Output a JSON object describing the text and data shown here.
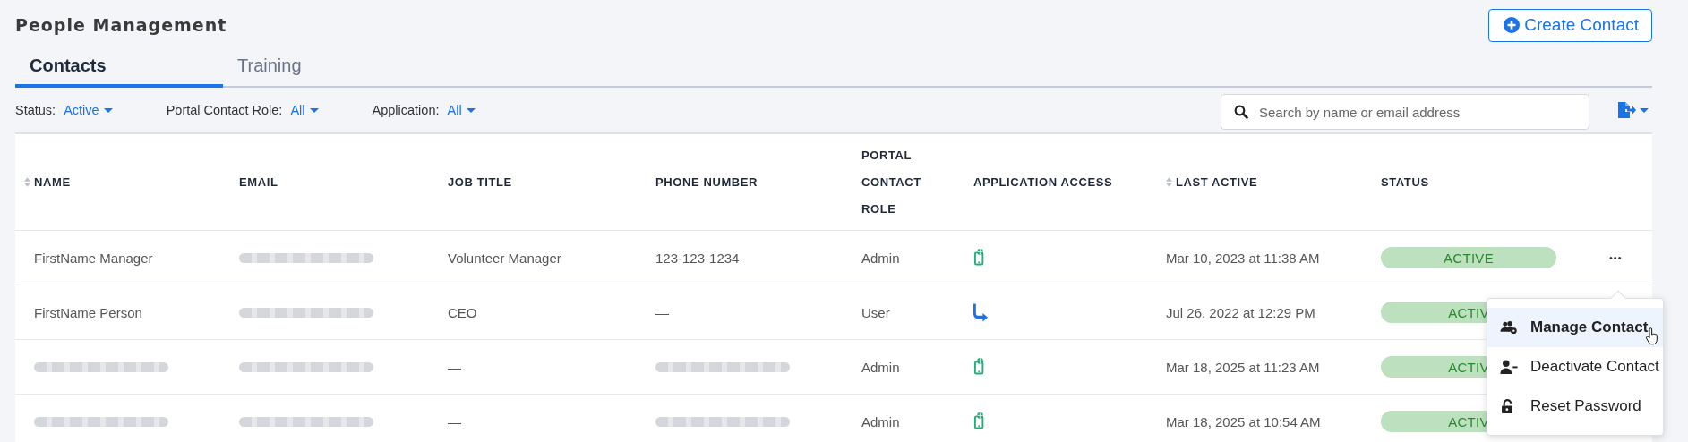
{
  "page": {
    "title": "People Management",
    "create_button": "Create Contact"
  },
  "tabs": [
    {
      "label": "Contacts",
      "selected": true
    },
    {
      "label": "Training",
      "selected": false
    }
  ],
  "filters": [
    {
      "label": "Status:",
      "value": "Active"
    },
    {
      "label": "Portal Contact Role:",
      "value": "All"
    },
    {
      "label": "Application:",
      "value": "All"
    }
  ],
  "search": {
    "placeholder": "Search by name or email address"
  },
  "table": {
    "columns": [
      {
        "label": "NAME",
        "sortable": true
      },
      {
        "label": "EMAIL",
        "sortable": false
      },
      {
        "label": "JOB TITLE",
        "sortable": false
      },
      {
        "label": "PHONE NUMBER",
        "sortable": false
      },
      {
        "label": "PORTAL CONTACT ROLE",
        "sortable": false
      },
      {
        "label": "APPLICATION ACCESS",
        "sortable": false
      },
      {
        "label": "LAST ACTIVE",
        "sortable": true
      },
      {
        "label": "STATUS",
        "sortable": false
      }
    ],
    "rows": [
      {
        "name": {
          "kind": "text",
          "text": "FirstName Manager"
        },
        "email": {
          "kind": "blurred"
        },
        "job_title": "Volunteer Manager",
        "phone": {
          "kind": "text",
          "text": "123-123-1234"
        },
        "role": "Admin",
        "access": {
          "kind": "phone"
        },
        "last_active": "Mar 10, 2023 at 11:38 AM",
        "status": "ACTIVE",
        "actions": "•••"
      },
      {
        "name": {
          "kind": "text",
          "text": "FirstName Person"
        },
        "email": {
          "kind": "blurred"
        },
        "job_title": "CEO",
        "phone": {
          "kind": "text",
          "text": "—"
        },
        "role": "User",
        "access": {
          "kind": "arrow"
        },
        "last_active": "Jul 26, 2022 at 12:29 PM",
        "status": "ACTIV"
      },
      {
        "name": {
          "kind": "blurred"
        },
        "email": {
          "kind": "blurred"
        },
        "job_title": "—",
        "phone": {
          "kind": "blurred"
        },
        "role": "Admin",
        "access": {
          "kind": "phone"
        },
        "last_active": "Mar 18, 2025 at 11:23 AM",
        "status": "ACTIV"
      },
      {
        "name": {
          "kind": "blurred"
        },
        "email": {
          "kind": "blurred"
        },
        "job_title": "—",
        "phone": {
          "kind": "blurred"
        },
        "role": "Admin",
        "access": {
          "kind": "phone"
        },
        "last_active": "Mar 18, 2025 at 10:54 AM",
        "status": "ACTIV"
      }
    ]
  },
  "menu": {
    "items": [
      {
        "label": "Manage Contact",
        "kind": "manage",
        "selected": true
      },
      {
        "label": "Deactivate Contact",
        "kind": "deactivate",
        "selected": false
      },
      {
        "label": "Reset Password",
        "kind": "reset",
        "selected": false
      }
    ]
  }
}
